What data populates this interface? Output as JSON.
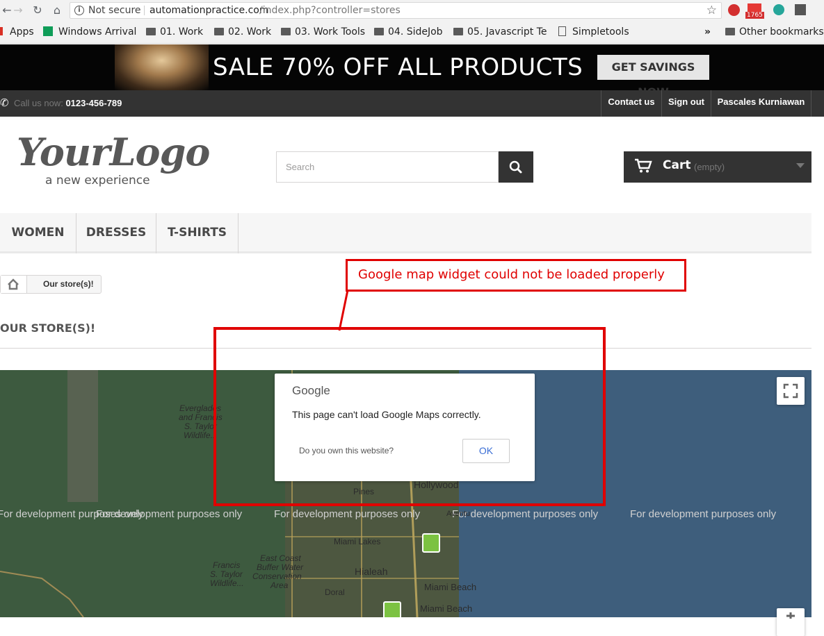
{
  "browser": {
    "security_label": "Not secure",
    "url_host": "automationpractice.com",
    "url_path": "/index.php?controller=stores",
    "ext_badge": "1765",
    "bookmarks": {
      "apps": "Apps",
      "items": [
        "Windows Arrival",
        "01. Work",
        "02. Work",
        "03. Work Tools",
        "04. SideJob",
        "05. Javascript Te",
        "Simpletools"
      ],
      "overflow": "»",
      "other": "Other bookmarks"
    }
  },
  "banner": {
    "title": "SALE 70% OFF ALL PRODUCTS",
    "button": "GET SAVINGS NOW"
  },
  "topnav": {
    "call_label": "Call us now:",
    "phone": "0123-456-789",
    "links": [
      "Contact us",
      "Sign out",
      "Pascales Kurniawan"
    ]
  },
  "header": {
    "logo_main": "YourLogo",
    "logo_sub": "a new experience",
    "search_placeholder": "Search",
    "cart_label": "Cart",
    "cart_status": "(empty)"
  },
  "menu": [
    "WOMEN",
    "DRESSES",
    "T-SHIRTS"
  ],
  "breadcrumb": {
    "current": "Our store(s)!"
  },
  "page": {
    "heading": "OUR STORE(S)!"
  },
  "map": {
    "dev_text": "For development purposes only",
    "places": {
      "everglades1": "Everglades",
      "everglades2": "and Francis",
      "everglades3": "S. Taylor",
      "everglades4": "Wildlife...",
      "francis1": "Francis",
      "francis2": "S. Taylor",
      "francis3": "Wildlife...",
      "eastcoast1": "East Coast",
      "eastcoast2": "Buffer Water",
      "eastcoast3": "Conservation",
      "eastcoast4": "Area",
      "hollywood": "Hollywood",
      "pines": "Pines",
      "miamilakes": "Miami Lakes",
      "hialeah": "Hialeah",
      "doral": "Doral",
      "miamibeach1": "Miami Beach",
      "miamibeach2": "Miami Beach",
      "aventura": "Aventu"
    },
    "dialog": {
      "brand": "Google",
      "message": "This page can't load Google Maps correctly.",
      "question": "Do you own this website?",
      "ok": "OK"
    }
  },
  "annotation": "Google map widget could not be loaded properly",
  "colors": {
    "annotation_red": "#e00000",
    "dark_bar": "#333333",
    "map_water": "#3e5e7c",
    "map_land": "#3d5a3f"
  }
}
